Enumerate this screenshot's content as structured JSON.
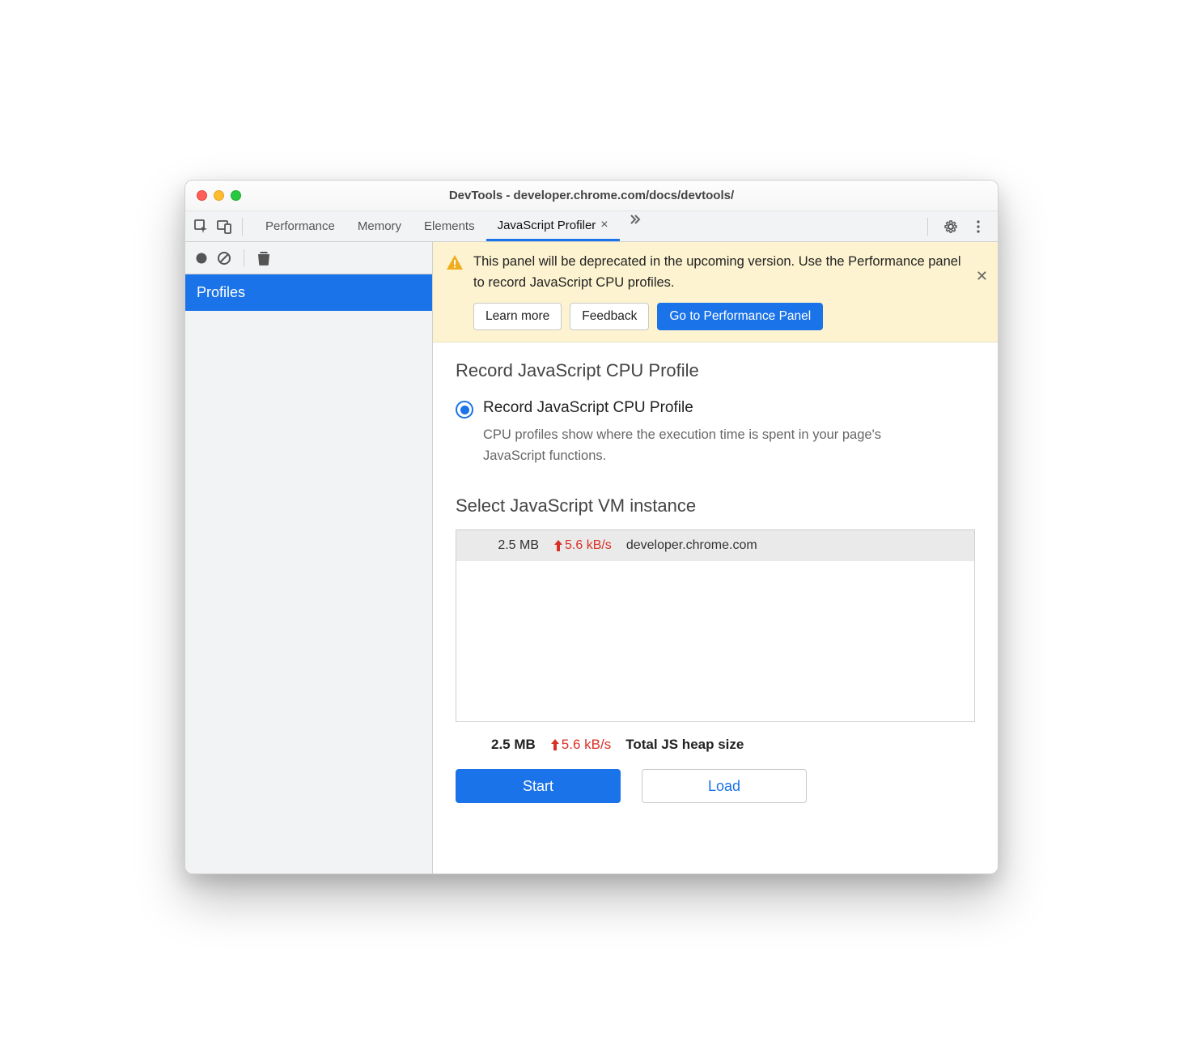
{
  "window": {
    "title": "DevTools - developer.chrome.com/docs/devtools/"
  },
  "tabs": {
    "items": [
      "Performance",
      "Memory",
      "Elements",
      "JavaScript Profiler"
    ],
    "active_index": 3
  },
  "sidebar": {
    "items": [
      {
        "label": "Profiles",
        "selected": true
      }
    ]
  },
  "banner": {
    "text": "This panel will be deprecated in the upcoming version. Use the Performance panel to record JavaScript CPU profiles.",
    "learn_more": "Learn more",
    "feedback": "Feedback",
    "go_to_panel": "Go to Performance Panel"
  },
  "profile": {
    "heading": "Record JavaScript CPU Profile",
    "option_label": "Record JavaScript CPU Profile",
    "option_desc": "CPU profiles show where the execution time is spent in your page's JavaScript functions."
  },
  "vm": {
    "heading": "Select JavaScript VM instance",
    "row": {
      "size": "2.5 MB",
      "rate": "5.6 kB/s",
      "host": "developer.chrome.com"
    },
    "totals": {
      "size": "2.5 MB",
      "rate": "5.6 kB/s",
      "label": "Total JS heap size"
    }
  },
  "actions": {
    "start": "Start",
    "load": "Load"
  }
}
